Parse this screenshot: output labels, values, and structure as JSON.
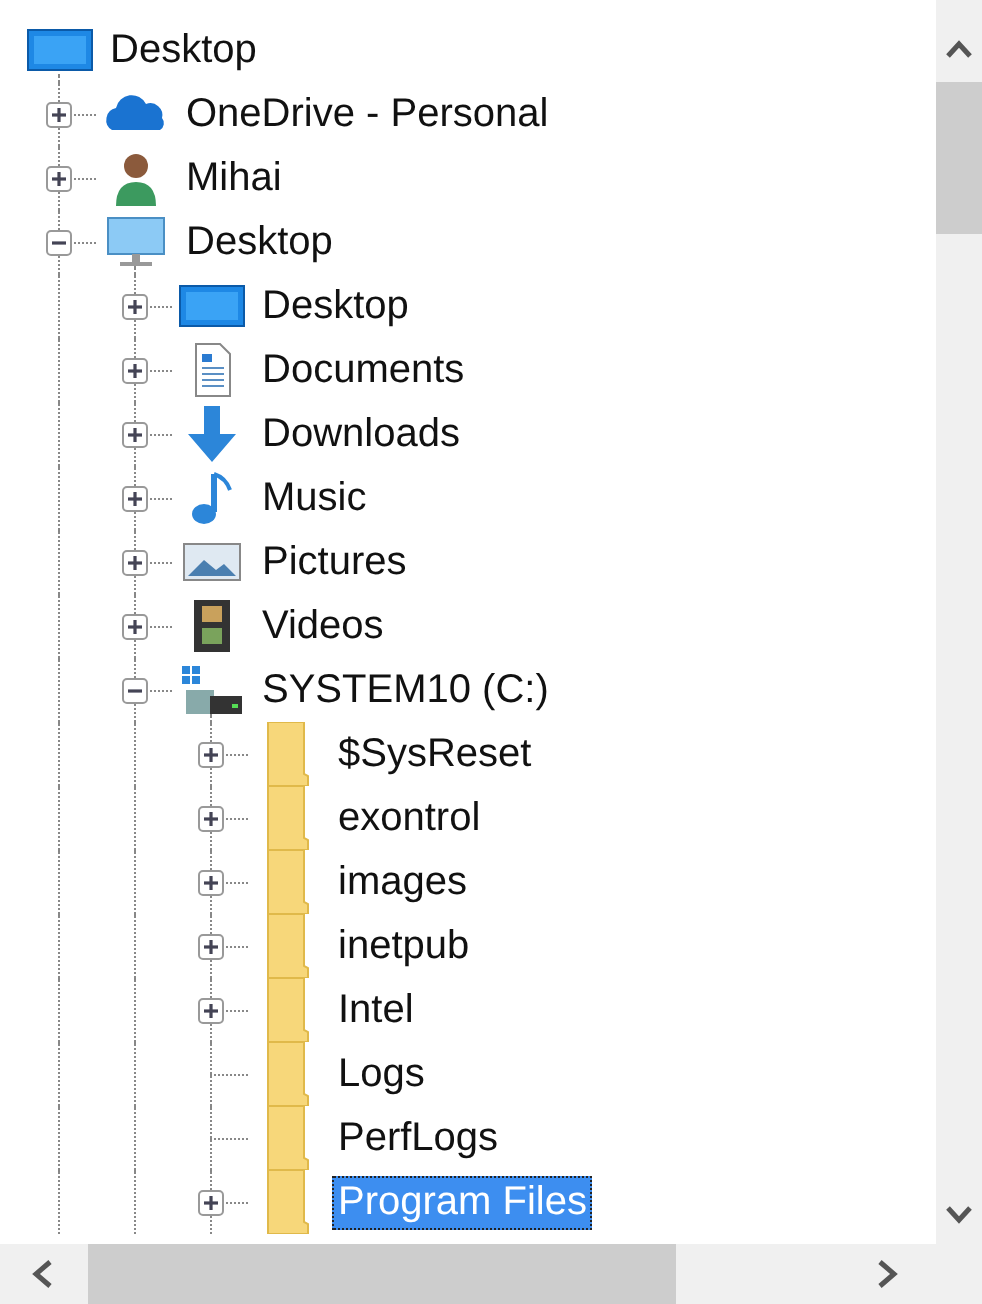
{
  "tree": {
    "label": "Desktop",
    "kind": "monitor",
    "selected": false,
    "children": [
      {
        "label": "OneDrive - Personal",
        "kind": "cloud",
        "expanded": false,
        "selected": false
      },
      {
        "label": "Mihai",
        "kind": "person",
        "expanded": false,
        "selected": false
      },
      {
        "label": "Desktop",
        "kind": "computer",
        "expanded": true,
        "selected": false,
        "children": [
          {
            "label": "Desktop",
            "kind": "monitor",
            "expanded": false,
            "selected": false
          },
          {
            "label": "Documents",
            "kind": "document",
            "expanded": false,
            "selected": false
          },
          {
            "label": "Downloads",
            "kind": "download",
            "expanded": false,
            "selected": false
          },
          {
            "label": "Music",
            "kind": "music",
            "expanded": false,
            "selected": false
          },
          {
            "label": "Pictures",
            "kind": "picture",
            "expanded": false,
            "selected": false
          },
          {
            "label": "Videos",
            "kind": "film",
            "expanded": false,
            "selected": false
          },
          {
            "label": "SYSTEM10 (C:)",
            "kind": "drive",
            "expanded": true,
            "selected": false,
            "children": [
              {
                "label": "$SysReset",
                "kind": "folder",
                "expanded": false,
                "selected": false
              },
              {
                "label": "exontrol",
                "kind": "folder",
                "expanded": false,
                "selected": false
              },
              {
                "label": "images",
                "kind": "folder",
                "expanded": false,
                "selected": false
              },
              {
                "label": "inetpub",
                "kind": "folder",
                "expanded": false,
                "selected": false
              },
              {
                "label": "Intel",
                "kind": "folder",
                "expanded": false,
                "selected": false
              },
              {
                "label": "Logs",
                "kind": "folder",
                "selected": false
              },
              {
                "label": "PerfLogs",
                "kind": "folder",
                "selected": false
              },
              {
                "label": "Program Files",
                "kind": "folder",
                "expanded": false,
                "selected": true
              }
            ]
          }
        ]
      }
    ]
  }
}
